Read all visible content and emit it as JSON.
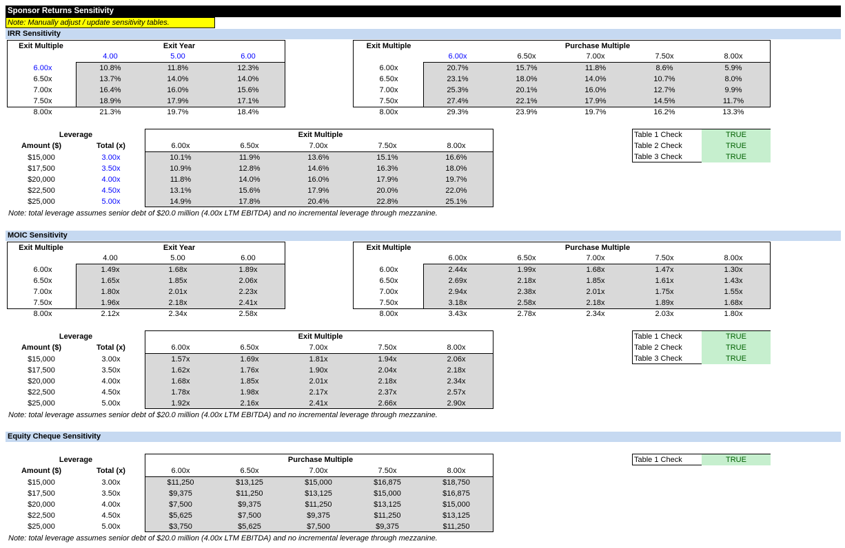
{
  "title": "Sponsor Returns Sensitivity",
  "note_top": "Note: Manually adjust / update sensitivity tables.",
  "irr": {
    "section": "IRR Sensitivity",
    "left": {
      "row_label": "Exit Multiple",
      "col_label": "Exit Year",
      "cols": [
        "4.00",
        "5.00",
        "6.00"
      ],
      "rows": [
        "6.00x",
        "6.50x",
        "7.00x",
        "7.50x",
        "8.00x"
      ],
      "cells": [
        [
          "10.8%",
          "11.8%",
          "12.3%"
        ],
        [
          "13.7%",
          "14.0%",
          "14.0%"
        ],
        [
          "16.4%",
          "16.0%",
          "15.6%"
        ],
        [
          "18.9%",
          "17.9%",
          "17.1%"
        ],
        [
          "21.3%",
          "19.7%",
          "18.4%"
        ]
      ]
    },
    "right": {
      "row_label": "Exit Multiple",
      "col_label": "Purchase Multiple",
      "cols": [
        "6.00x",
        "6.50x",
        "7.00x",
        "7.50x",
        "8.00x"
      ],
      "rows": [
        "6.00x",
        "6.50x",
        "7.00x",
        "7.50x",
        "8.00x"
      ],
      "cells": [
        [
          "20.7%",
          "15.7%",
          "11.8%",
          "8.6%",
          "5.9%"
        ],
        [
          "23.1%",
          "18.0%",
          "14.0%",
          "10.7%",
          "8.0%"
        ],
        [
          "25.3%",
          "20.1%",
          "16.0%",
          "12.7%",
          "9.9%"
        ],
        [
          "27.4%",
          "22.1%",
          "17.9%",
          "14.5%",
          "11.7%"
        ],
        [
          "29.3%",
          "23.9%",
          "19.7%",
          "16.2%",
          "13.3%"
        ]
      ]
    },
    "lev": {
      "group_label": "Leverage",
      "amt_label": "Amount ($)",
      "tot_label": "Total (x)",
      "col_label": "Exit Multiple",
      "cols": [
        "6.00x",
        "6.50x",
        "7.00x",
        "7.50x",
        "8.00x"
      ],
      "amounts": [
        "$15,000",
        "$17,500",
        "$20,000",
        "$22,500",
        "$25,000"
      ],
      "totals": [
        "3.00x",
        "3.50x",
        "4.00x",
        "4.50x",
        "5.00x"
      ],
      "cells": [
        [
          "10.1%",
          "11.9%",
          "13.6%",
          "15.1%",
          "16.6%"
        ],
        [
          "10.9%",
          "12.8%",
          "14.6%",
          "16.3%",
          "18.0%"
        ],
        [
          "11.8%",
          "14.0%",
          "16.0%",
          "17.9%",
          "19.7%"
        ],
        [
          "13.1%",
          "15.6%",
          "17.9%",
          "20.0%",
          "22.0%"
        ],
        [
          "14.9%",
          "17.8%",
          "20.4%",
          "22.8%",
          "25.1%"
        ]
      ]
    },
    "checks": [
      {
        "label": "Table 1 Check",
        "value": "TRUE"
      },
      {
        "label": "Table 2 Check",
        "value": "TRUE"
      },
      {
        "label": "Table 3 Check",
        "value": "TRUE"
      }
    ],
    "note": "Note: total leverage assumes senior debt of $20.0 million (4.00x LTM EBITDA) and no incremental leverage through mezzanine."
  },
  "moic": {
    "section": "MOIC Sensitivity",
    "left": {
      "row_label": "Exit Multiple",
      "col_label": "Exit Year",
      "cols": [
        "4.00",
        "5.00",
        "6.00"
      ],
      "rows": [
        "6.00x",
        "6.50x",
        "7.00x",
        "7.50x",
        "8.00x"
      ],
      "cells": [
        [
          "1.49x",
          "1.68x",
          "1.89x"
        ],
        [
          "1.65x",
          "1.85x",
          "2.06x"
        ],
        [
          "1.80x",
          "2.01x",
          "2.23x"
        ],
        [
          "1.96x",
          "2.18x",
          "2.41x"
        ],
        [
          "2.12x",
          "2.34x",
          "2.58x"
        ]
      ]
    },
    "right": {
      "row_label": "Exit Multiple",
      "col_label": "Purchase Multiple",
      "cols": [
        "6.00x",
        "6.50x",
        "7.00x",
        "7.50x",
        "8.00x"
      ],
      "rows": [
        "6.00x",
        "6.50x",
        "7.00x",
        "7.50x",
        "8.00x"
      ],
      "cells": [
        [
          "2.44x",
          "1.99x",
          "1.68x",
          "1.47x",
          "1.30x"
        ],
        [
          "2.69x",
          "2.18x",
          "1.85x",
          "1.61x",
          "1.43x"
        ],
        [
          "2.94x",
          "2.38x",
          "2.01x",
          "1.75x",
          "1.55x"
        ],
        [
          "3.18x",
          "2.58x",
          "2.18x",
          "1.89x",
          "1.68x"
        ],
        [
          "3.43x",
          "2.78x",
          "2.34x",
          "2.03x",
          "1.80x"
        ]
      ]
    },
    "lev": {
      "group_label": "Leverage",
      "amt_label": "Amount ($)",
      "tot_label": "Total (x)",
      "col_label": "Exit Multiple",
      "cols": [
        "6.00x",
        "6.50x",
        "7.00x",
        "7.50x",
        "8.00x"
      ],
      "amounts": [
        "$15,000",
        "$17,500",
        "$20,000",
        "$22,500",
        "$25,000"
      ],
      "totals": [
        "3.00x",
        "3.50x",
        "4.00x",
        "4.50x",
        "5.00x"
      ],
      "cells": [
        [
          "1.57x",
          "1.69x",
          "1.81x",
          "1.94x",
          "2.06x"
        ],
        [
          "1.62x",
          "1.76x",
          "1.90x",
          "2.04x",
          "2.18x"
        ],
        [
          "1.68x",
          "1.85x",
          "2.01x",
          "2.18x",
          "2.34x"
        ],
        [
          "1.78x",
          "1.98x",
          "2.17x",
          "2.37x",
          "2.57x"
        ],
        [
          "1.92x",
          "2.16x",
          "2.41x",
          "2.66x",
          "2.90x"
        ]
      ]
    },
    "checks": [
      {
        "label": "Table 1 Check",
        "value": "TRUE"
      },
      {
        "label": "Table 2 Check",
        "value": "TRUE"
      },
      {
        "label": "Table 3 Check",
        "value": "TRUE"
      }
    ],
    "note": "Note: total leverage assumes senior debt of $20.0 million (4.00x LTM EBITDA) and no incremental leverage through mezzanine."
  },
  "equity": {
    "section": "Equity Cheque Sensitivity",
    "lev": {
      "group_label": "Leverage",
      "amt_label": "Amount ($)",
      "tot_label": "Total (x)",
      "col_label": "Purchase Multiple",
      "cols": [
        "6.00x",
        "6.50x",
        "7.00x",
        "7.50x",
        "8.00x"
      ],
      "amounts": [
        "$15,000",
        "$17,500",
        "$20,000",
        "$22,500",
        "$25,000"
      ],
      "totals": [
        "3.00x",
        "3.50x",
        "4.00x",
        "4.50x",
        "5.00x"
      ],
      "cells": [
        [
          "$11,250",
          "$13,125",
          "$15,000",
          "$16,875",
          "$18,750"
        ],
        [
          "$9,375",
          "$11,250",
          "$13,125",
          "$15,000",
          "$16,875"
        ],
        [
          "$7,500",
          "$9,375",
          "$11,250",
          "$13,125",
          "$15,000"
        ],
        [
          "$5,625",
          "$7,500",
          "$9,375",
          "$11,250",
          "$13,125"
        ],
        [
          "$3,750",
          "$5,625",
          "$7,500",
          "$9,375",
          "$11,250"
        ]
      ]
    },
    "checks": [
      {
        "label": "Table 1 Check",
        "value": "TRUE"
      }
    ],
    "note": "Note: total leverage assumes senior debt of $20.0 million (4.00x LTM EBITDA) and no incremental leverage through mezzanine."
  },
  "colors": {
    "title_bg": "#000000",
    "note_bg": "#ffff00",
    "section_bg": "#c6d9f1",
    "cell_shade": "#d9d9d9",
    "check_bg": "#c6efce",
    "check_fg": "#006100",
    "input_blue": "#0000ff"
  }
}
